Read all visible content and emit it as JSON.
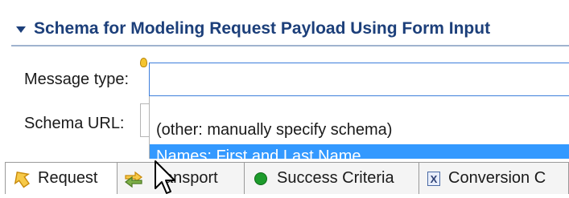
{
  "section": {
    "title": "Schema for Modeling Request Payload Using Form Input",
    "expanded": true
  },
  "form": {
    "message_type_label": "Message type:",
    "message_type_value": "",
    "schema_url_label": "Schema URL:"
  },
  "dropdown": {
    "options": [
      "(other: manually specify schema)",
      "Names: First and Last Name"
    ],
    "selected_index": 1
  },
  "tabs": [
    {
      "label": "Request",
      "icon": "request-arrow-icon",
      "active": true
    },
    {
      "label": "ansport",
      "icon": "transport-icon",
      "active": false
    },
    {
      "label": "Success Criteria",
      "icon": "green-dot-icon",
      "active": false
    },
    {
      "label": "Conversion C",
      "icon": "x-box-icon",
      "active": false
    }
  ],
  "colors": {
    "header_text": "#1c3f7a",
    "selection": "#3399ff",
    "focus_border": "#3d7edb"
  }
}
